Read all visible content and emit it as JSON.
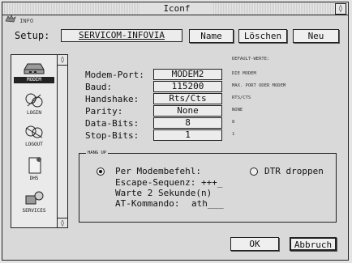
{
  "window": {
    "title": "Iconf",
    "close_glyph": "◊"
  },
  "info_label": "INFO",
  "setup": {
    "label": "Setup:",
    "value": "SERVICOM-INFOVIA"
  },
  "buttons": {
    "name": "Name",
    "delete": "Löschen",
    "new": "Neu",
    "ok": "OK",
    "cancel": "Abbruch"
  },
  "sidebar": [
    {
      "label": "MODEM",
      "icon": "modem-icon",
      "selected": true
    },
    {
      "label": "LOGIN",
      "icon": "login-icon",
      "selected": false
    },
    {
      "label": "LOGOUT",
      "icon": "logout-icon",
      "selected": false
    },
    {
      "label": "DHS",
      "icon": "document-icon",
      "selected": false
    },
    {
      "label": "SERVICES",
      "icon": "services-icon",
      "selected": false
    }
  ],
  "settings": [
    {
      "label": "Modem-Port:",
      "value": "MODEM2"
    },
    {
      "label": "Baud:",
      "value": "115200"
    },
    {
      "label": "Handshake:",
      "value": "Rts/Cts"
    },
    {
      "label": "Parity:",
      "value": "None"
    },
    {
      "label": "Data-Bits:",
      "value": "8"
    },
    {
      "label": "Stop-Bits:",
      "value": "1"
    }
  ],
  "defaults": {
    "header": "DEFAULT-WERTE:",
    "values": [
      "DIE MODEM",
      "MAX. PORT ODER MODEM",
      "RTS/CTS",
      "NONE",
      "8",
      "1"
    ]
  },
  "hangup": {
    "group_label": "HANG UP",
    "by_command": "Per Modembefehl:",
    "dtr": "DTR droppen",
    "escape_label": "Escape-Sequenz:",
    "escape_value": "+++_",
    "wait": "Warte 2 Sekunde(n)",
    "at_label": "AT-Kommando:",
    "at_value": "ath___",
    "selected": "by_command"
  }
}
